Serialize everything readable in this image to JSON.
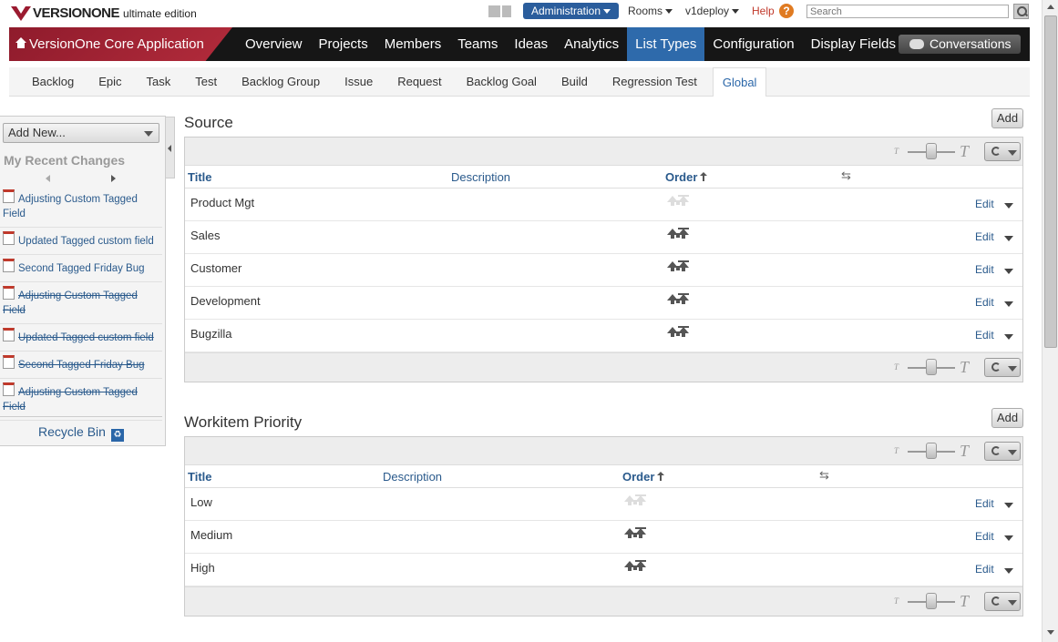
{
  "brand": {
    "logo": "VERSIONONE",
    "edition": "ultimate edition"
  },
  "topbar": {
    "administration": "Administration",
    "rooms": "Rooms",
    "user": "v1deploy",
    "help": "Help",
    "help_icon_text": "?",
    "search_placeholder": "Search"
  },
  "mainnav": {
    "app_name": "VersionOne Core Application",
    "items": [
      "Overview",
      "Projects",
      "Members",
      "Teams",
      "Ideas",
      "Analytics",
      "List Types",
      "Configuration",
      "Display Fields"
    ],
    "active": "List Types",
    "conversations": "Conversations"
  },
  "subnav": {
    "items": [
      "Backlog",
      "Epic",
      "Task",
      "Test",
      "Backlog Group",
      "Issue",
      "Request",
      "Backlog Goal",
      "Build",
      "Regression Test",
      "Global"
    ],
    "active": "Global"
  },
  "leftpanel": {
    "add_new": "Add New...",
    "recent_title": "My Recent Changes",
    "recent": [
      {
        "text": "Adjusting Custom Tagged Field",
        "struck": false
      },
      {
        "text": "Updated Tagged custom field",
        "struck": false
      },
      {
        "text": "Second Tagged Friday Bug",
        "struck": false
      },
      {
        "text": "Adjusting Custom Tagged Field",
        "struck": true
      },
      {
        "text": "Updated Tagged custom field",
        "struck": true
      },
      {
        "text": "Second Tagged Friday Bug",
        "struck": true
      },
      {
        "text": "Adjusting Custom Tagged Field",
        "struck": true
      }
    ],
    "recycle_bin": "Recycle Bin"
  },
  "grid_labels": {
    "size_small": "T",
    "size_large": "T",
    "edit": "Edit"
  },
  "sections": [
    {
      "title": "Source",
      "add_label": "Add",
      "columns": {
        "title": "Title",
        "description": "Description",
        "order": "Order"
      },
      "rows": [
        {
          "title": "Product Mgt",
          "order_enabled": false
        },
        {
          "title": "Sales",
          "order_enabled": true
        },
        {
          "title": "Customer",
          "order_enabled": true
        },
        {
          "title": "Development",
          "order_enabled": true
        },
        {
          "title": "Bugzilla",
          "order_enabled": true
        }
      ]
    },
    {
      "title": "Workitem Priority",
      "add_label": "Add",
      "columns": {
        "title": "Title",
        "description": "Description",
        "order": "Order"
      },
      "rows": [
        {
          "title": "Low",
          "order_enabled": false
        },
        {
          "title": "Medium",
          "order_enabled": true
        },
        {
          "title": "High",
          "order_enabled": true
        }
      ]
    }
  ]
}
